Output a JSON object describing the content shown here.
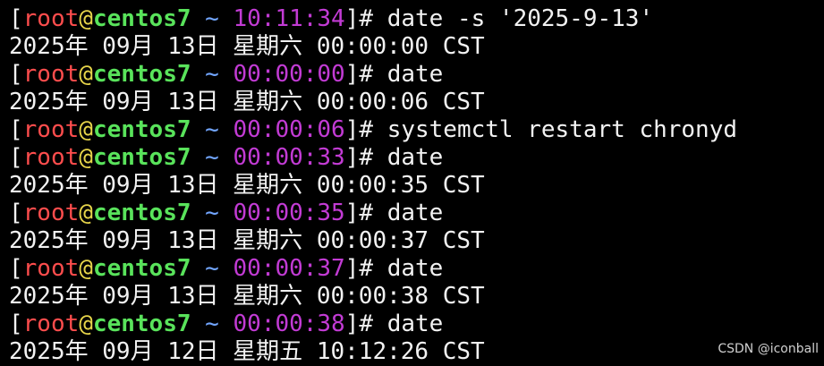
{
  "prompt": {
    "open_bracket": "[",
    "user": "root",
    "at": "@",
    "host": "centos7",
    "tilde": " ~ ",
    "close": "]",
    "hash": "# "
  },
  "lines": [
    {
      "type": "prompt",
      "time": "10:11:34",
      "command": "date -s '2025-9-13'"
    },
    {
      "type": "output",
      "text": "2025年 09月 13日 星期六 00:00:00 CST"
    },
    {
      "type": "prompt",
      "time": "00:00:00",
      "command": "date"
    },
    {
      "type": "output",
      "text": "2025年 09月 13日 星期六 00:00:06 CST"
    },
    {
      "type": "prompt",
      "time": "00:00:06",
      "command": "systemctl restart chronyd"
    },
    {
      "type": "prompt",
      "time": "00:00:33",
      "command": "date"
    },
    {
      "type": "output",
      "text": "2025年 09月 13日 星期六 00:00:35 CST"
    },
    {
      "type": "prompt",
      "time": "00:00:35",
      "command": "date"
    },
    {
      "type": "output",
      "text": "2025年 09月 13日 星期六 00:00:37 CST"
    },
    {
      "type": "prompt",
      "time": "00:00:37",
      "command": "date"
    },
    {
      "type": "output",
      "text": "2025年 09月 13日 星期六 00:00:38 CST"
    },
    {
      "type": "prompt",
      "time": "00:00:38",
      "command": "date"
    },
    {
      "type": "output",
      "text": "2025年 09月 12日 星期五 10:12:26 CST"
    }
  ],
  "watermark": "CSDN @iconball",
  "colors": {
    "background": "#000000",
    "user": "#ff4d4d",
    "host": "#59e35b",
    "time": "#c23bd4",
    "text": "#f2f2f2"
  }
}
